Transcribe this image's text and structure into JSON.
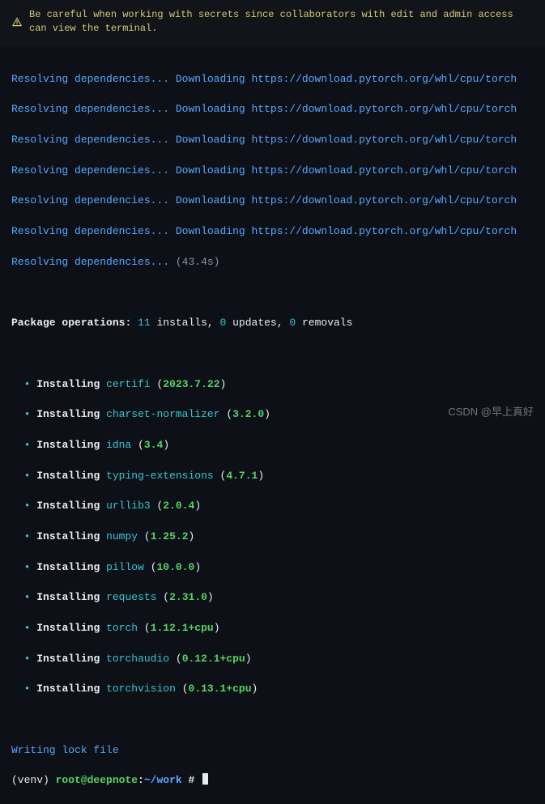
{
  "banner": {
    "text": "Be careful when working with secrets since collaborators with edit and admin access can view the terminal."
  },
  "resolving": {
    "prefix": "Resolving dependencies...",
    "downloading": "Downloading",
    "url": "https://download.pytorch.org/whl/cpu/torch",
    "duration": "(43.4s)"
  },
  "summary": {
    "label": "Package operations",
    "installs_n": "11",
    "installs_t": "installs,",
    "updates_n": "0",
    "updates_t": "updates,",
    "removals_n": "0",
    "removals_t": "removals"
  },
  "installs": [
    {
      "name": "certifi",
      "ver": "2023.7.22"
    },
    {
      "name": "charset-normalizer",
      "ver": "3.2.0"
    },
    {
      "name": "idna",
      "ver": "3.4"
    },
    {
      "name": "typing-extensions",
      "ver": "4.7.1"
    },
    {
      "name": "urllib3",
      "ver": "2.0.4"
    },
    {
      "name": "numpy",
      "ver": "1.25.2"
    },
    {
      "name": "pillow",
      "ver": "10.0.0"
    },
    {
      "name": "requests",
      "ver": "2.31.0"
    },
    {
      "name": "torch",
      "ver": "1.12.1+cpu"
    },
    {
      "name": "torchaudio",
      "ver": "0.12.1+cpu"
    },
    {
      "name": "torchvision",
      "ver": "0.13.1+cpu"
    }
  ],
  "install_word": "Installing",
  "writing": "Writing lock file",
  "prompt": {
    "venv": "(venv)",
    "user_host": "root@deepnote",
    "sep": ":",
    "path": "~/work",
    "hash": "#"
  },
  "watermark": "CSDN @早上真好"
}
